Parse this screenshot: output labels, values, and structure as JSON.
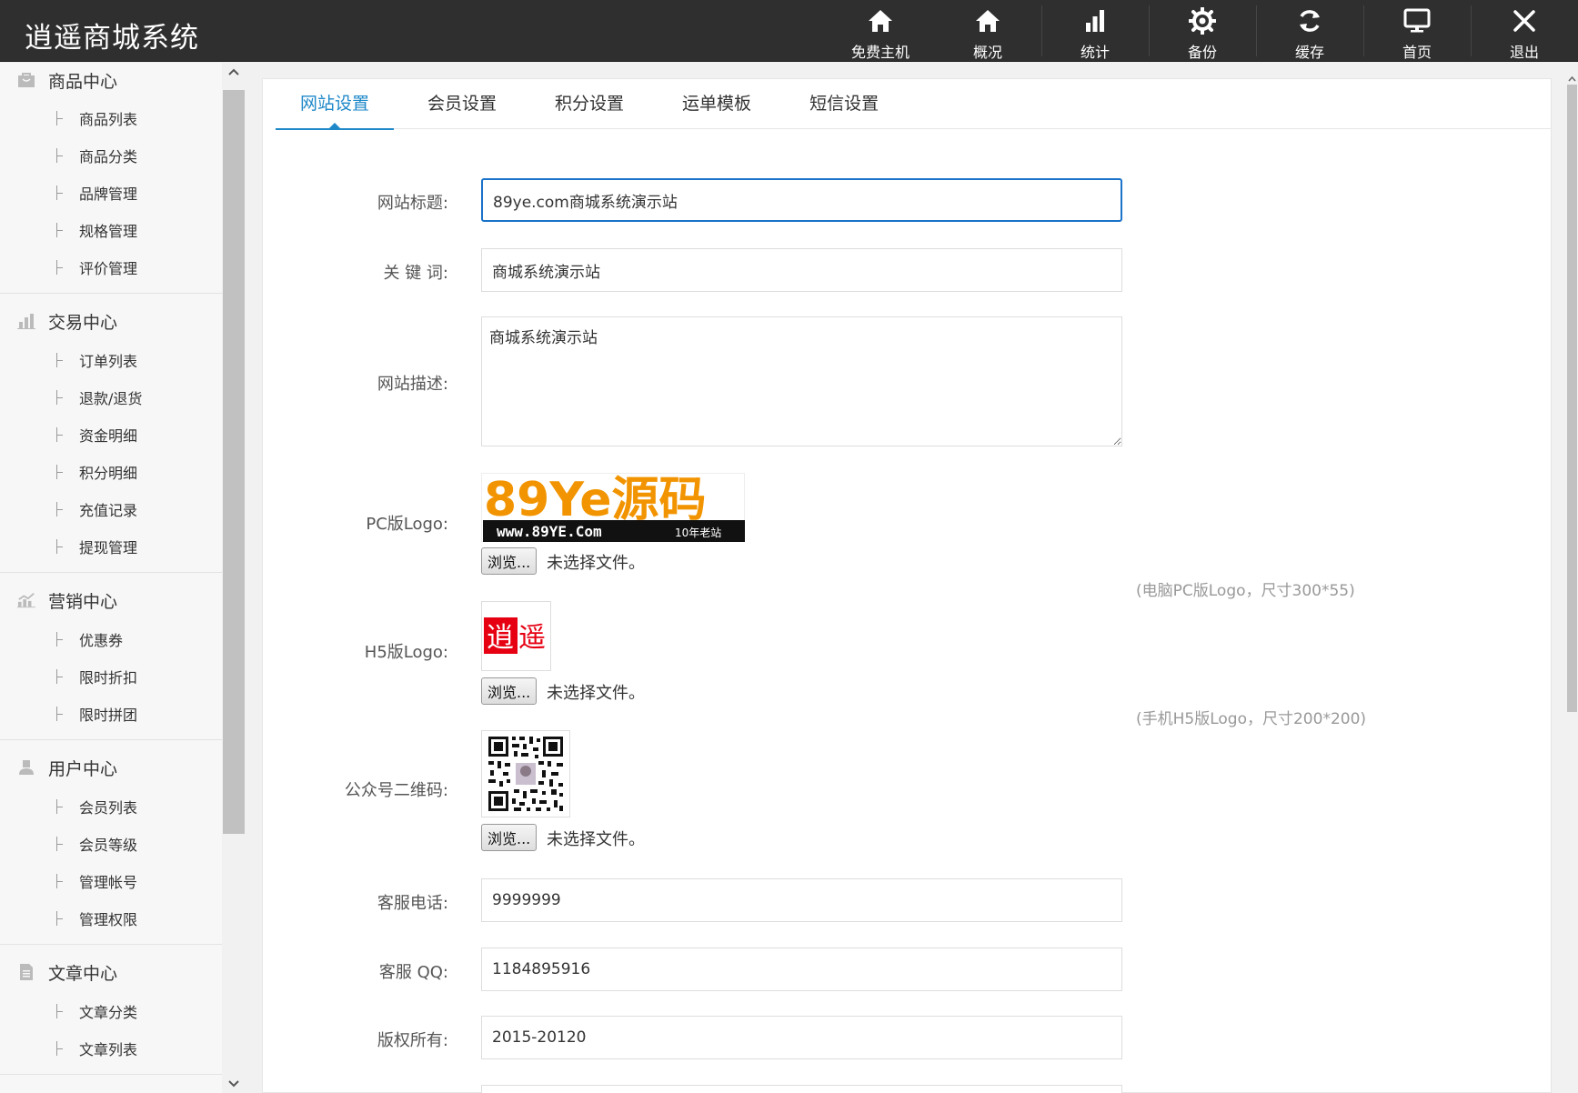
{
  "app": {
    "title": "逍遥商城系统"
  },
  "topnav": [
    {
      "label": "免费主机",
      "icon": "home-icon"
    },
    {
      "label": "概况",
      "icon": "home-icon"
    },
    {
      "label": "统计",
      "icon": "bar-chart-icon"
    },
    {
      "label": "备份",
      "icon": "gear-icon"
    },
    {
      "label": "缓存",
      "icon": "refresh-icon"
    },
    {
      "label": "首页",
      "icon": "monitor-icon"
    },
    {
      "label": "退出",
      "icon": "close-icon"
    }
  ],
  "sidebar": {
    "groups": [
      {
        "title": "商品中心",
        "icon": "bag-icon",
        "items": [
          "商品列表",
          "商品分类",
          "品牌管理",
          "规格管理",
          "评价管理"
        ]
      },
      {
        "title": "交易中心",
        "icon": "bar-chart-icon",
        "items": [
          "订单列表",
          "退款/退货",
          "资金明细",
          "积分明细",
          "充值记录",
          "提现管理"
        ]
      },
      {
        "title": "营销中心",
        "icon": "trend-chart-icon",
        "items": [
          "优惠券",
          "限时折扣",
          "限时拼团"
        ]
      },
      {
        "title": "用户中心",
        "icon": "user-icon",
        "items": [
          "会员列表",
          "会员等级",
          "管理帐号",
          "管理权限"
        ]
      },
      {
        "title": "文章中心",
        "icon": "document-icon",
        "items": [
          "文章分类",
          "文章列表"
        ]
      }
    ]
  },
  "tabs": [
    "网站设置",
    "会员设置",
    "积分设置",
    "运单模板",
    "短信设置"
  ],
  "form": {
    "site_title": {
      "label": "网站标题:",
      "value": "89ye.com商城系统演示站"
    },
    "keywords": {
      "label": "关 键 词:",
      "value": "商城系统演示站"
    },
    "description": {
      "label": "网站描述:",
      "value": "商城系统演示站"
    },
    "pc_logo": {
      "label": "PC版Logo:",
      "hint": "(电脑PC版Logo，尺寸300*55)",
      "logo_main": "89Ye源码",
      "logo_url": "www.89YE.Com",
      "logo_tag": "10年老站"
    },
    "h5_logo": {
      "label": "H5版Logo:",
      "hint": "(手机H5版Logo，尺寸200*200)",
      "char1": "逍",
      "char2": "遥"
    },
    "qrcode": {
      "label": "公众号二维码:"
    },
    "browse_label": "浏览...",
    "no_file": "未选择文件。",
    "phone": {
      "label": "客服电话:",
      "value": "9999999"
    },
    "qq": {
      "label": "客服 QQ:",
      "value": "1184895916"
    },
    "copyright": {
      "label": "版权所有:",
      "value": "2015-20120"
    }
  },
  "colors": {
    "topbar": "#2f2f2f",
    "accent": "#1e88c8",
    "focus_border": "#1a73c9",
    "logo_orange": "#f29400",
    "logo_green": "#3e9a2c",
    "h5_red": "#e60012"
  }
}
